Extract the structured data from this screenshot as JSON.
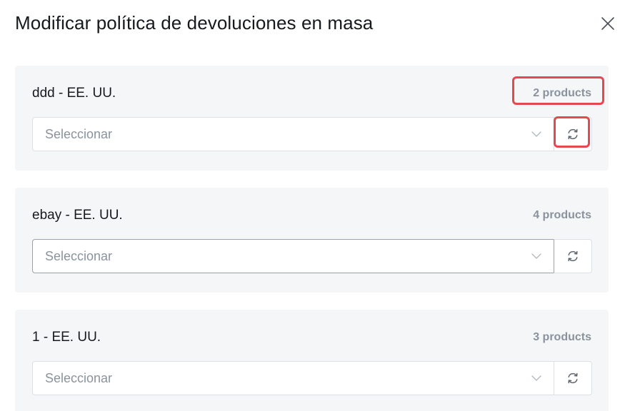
{
  "modal": {
    "title": "Modificar política de devoluciones en masa",
    "close_icon": "close-icon"
  },
  "cards": [
    {
      "title": "ddd - EE. UU.",
      "count": "2 products",
      "select_placeholder": "Seleccionar",
      "select_focused": false
    },
    {
      "title": "ebay - EE. UU.",
      "count": "4 products",
      "select_placeholder": "Seleccionar",
      "select_focused": true
    },
    {
      "title": "1 - EE. UU.",
      "count": "3 products",
      "select_placeholder": "Seleccionar",
      "select_focused": false
    }
  ],
  "icons": {
    "chevron": "chevron-down-icon",
    "refresh": "refresh-icon"
  },
  "colors": {
    "highlight": "#e5484d",
    "card_bg": "#f5f6f8",
    "muted_text": "#8a939d"
  }
}
